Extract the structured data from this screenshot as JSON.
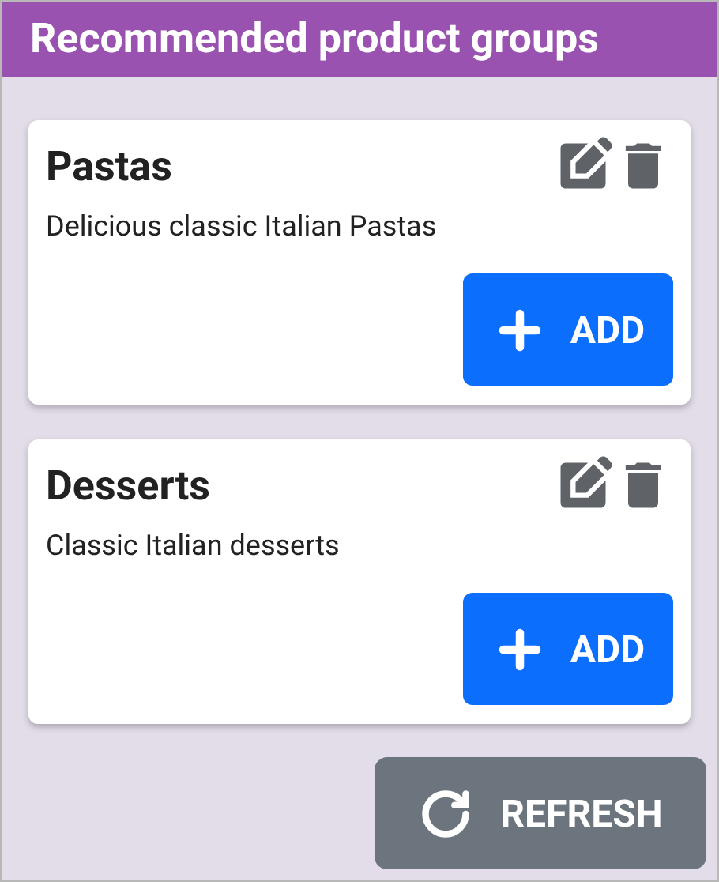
{
  "header": {
    "title": "Recommended product groups"
  },
  "groups": [
    {
      "name": "Pastas",
      "description": "Delicious classic Italian Pastas",
      "button": "ADD"
    },
    {
      "name": "Desserts",
      "description": "Classic Italian desserts",
      "button": "ADD"
    }
  ],
  "refresh_button": "REFRESH"
}
